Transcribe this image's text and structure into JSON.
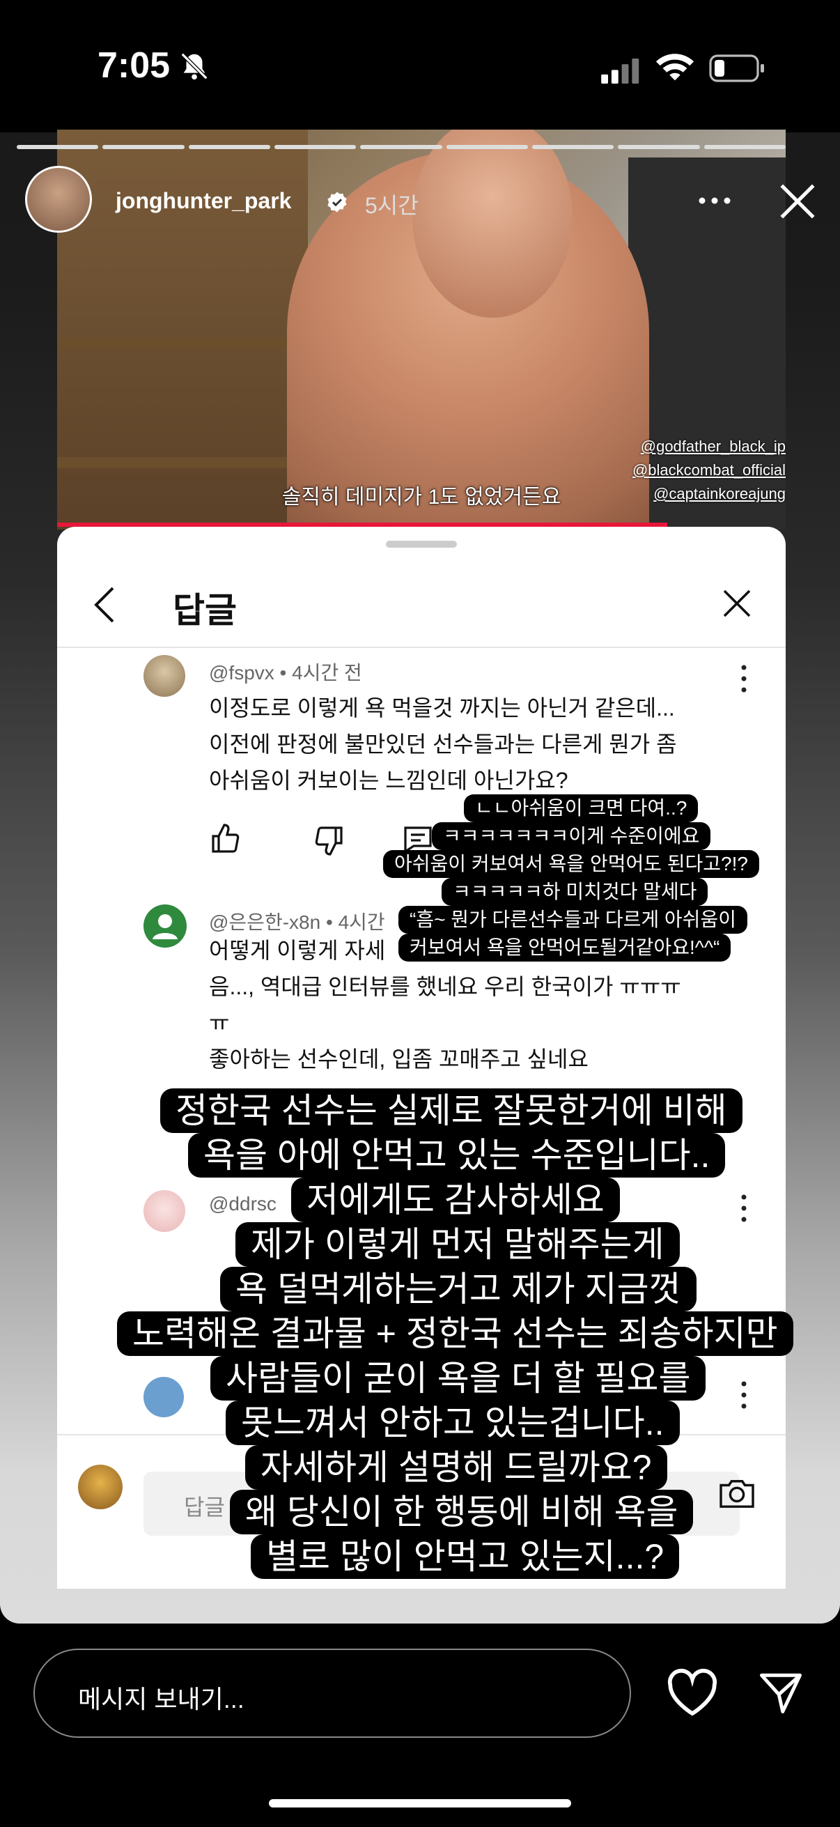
{
  "status_bar": {
    "time": "7:05"
  },
  "story": {
    "username": "jonghunter_park",
    "time_ago": "5시간",
    "subtitle": "솔직히 데미지가 1도 없었거든요",
    "credits": [
      "@godfather_black_ip",
      "@blackcombat_official",
      "@captainkoreajung"
    ],
    "progress_segments": 9
  },
  "sheet": {
    "title": "답글",
    "comments": [
      {
        "handle": "@fspvx",
        "time": "4시간 전",
        "lines": [
          "이정도로 이렇게 욕 먹을것 까지는 아닌거 같은데...",
          "이전에 판정에 불만있던 선수들과는 다른게 뭔가 좀",
          "아쉬움이 커보이는 느낌인데 아닌가요?"
        ]
      },
      {
        "handle": "@은은한-x8n",
        "time": "4시간",
        "lines": [
          "어떻게 이렇게 자세",
          "음..., 역대급 인터뷰를 했네요 우리 한국이가 ㅠㅠㅠ",
          "ㅠ",
          "좋아하는 선수인데, 입좀 꼬매주고 싶네요"
        ]
      },
      {
        "handle": "@ddrsc",
        "time": "",
        "lines": []
      }
    ],
    "reply_placeholder": "답글 추"
  },
  "captions_small": [
    "ㄴㄴ아쉬움이 크면 다여..?",
    "ㅋㅋㅋㅋㅋㅋㅋ이게 수준이에요",
    "아쉬움이 커보여서 욕을 안먹어도 된다고?!?",
    "ㅋㅋㅋㅋㅋ하 미치것다 말세다",
    "“흠~ 뭔가 다른선수들과 다르게 아쉬움이",
    "커보여서 욕을 안먹어도될거같아요!^^“"
  ],
  "captions_large": [
    "정한국 선수는 실제로 잘못한거에 비해",
    "욕을 아에 안먹고 있는 수준입니다..",
    "저에게도 감사하세요",
    "제가 이렇게 먼저 말해주는게",
    "욕 덜먹게하는거고 제가 지금껏",
    "노력해온 결과물 + 정한국 선수는 죄송하지만",
    "사람들이 굳이 욕을 더 할 필요를",
    "못느껴서 안하고 있는겁니다..",
    "자세하게 설명해 드릴까요?",
    "왜 당신이 한 행동에 비해 욕을",
    "별로 많이 안먹고 있는지...?"
  ],
  "bottom_bar": {
    "message_placeholder": "메시지 보내기..."
  },
  "colors": {
    "accent_red": "#e8173a",
    "verified_blue": "#3897f0"
  }
}
